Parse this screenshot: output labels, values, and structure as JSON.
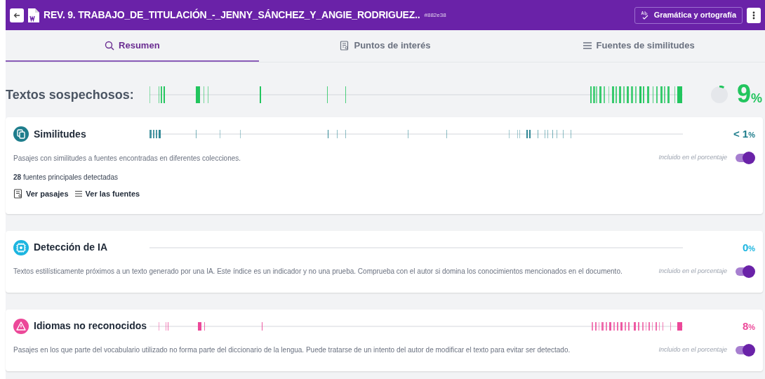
{
  "header": {
    "title": "REV. 9. TRABAJO_DE_TITULACIÓN_-_JENNY_SÁNCHEZ_Y_ANGIE_RODRIGUEZ..",
    "id_tag": "#882e38",
    "grammar_button": "Gramática y ortografía"
  },
  "tabs": [
    {
      "label": "Resumen",
      "selected": true,
      "kind": "summary"
    },
    {
      "label": "Puntos de interés",
      "selected": false,
      "kind": "points"
    },
    {
      "label": "Fuentes de similitudes",
      "selected": false,
      "kind": "sources"
    }
  ],
  "suspicious": {
    "label": "Textos sospechosos:",
    "value": "9",
    "unit": "%"
  },
  "sections": [
    {
      "kind": "similarity",
      "title": "Similitudes",
      "value": "< 1",
      "unit": "%",
      "description": "Pasajes con similitudes a fuentes encontradas en diferentes colecciones.",
      "toggle_label": "Incluido en el porcentaje",
      "on": true,
      "count": "28",
      "count_text": "fuentes principales detectadas",
      "links": [
        "Ver pasajes",
        "Ver las fuentes"
      ]
    },
    {
      "kind": "ai",
      "title": "Detección de IA",
      "value": "0",
      "unit": "%",
      "description": "Textos estilísticamente próximos a un texto generado por una IA. Este índice es un indicador y no una prueba. Comprueba con el autor si domina los conocimientos mencionados en el documento.",
      "toggle_label": "Incluido en el porcentaje",
      "on": true
    },
    {
      "kind": "language",
      "title": "Idiomas no reconocidos",
      "value": "8",
      "unit": "%",
      "description": "Pasajes en los que parte del vocabulario utilizado no forma parte del diccionario de la lengua. Puede tratarse de un intento del autor de modificar el texto para evitar ser detectado.",
      "toggle_label": "Incluido en el porcentaje",
      "on": true
    }
  ]
}
